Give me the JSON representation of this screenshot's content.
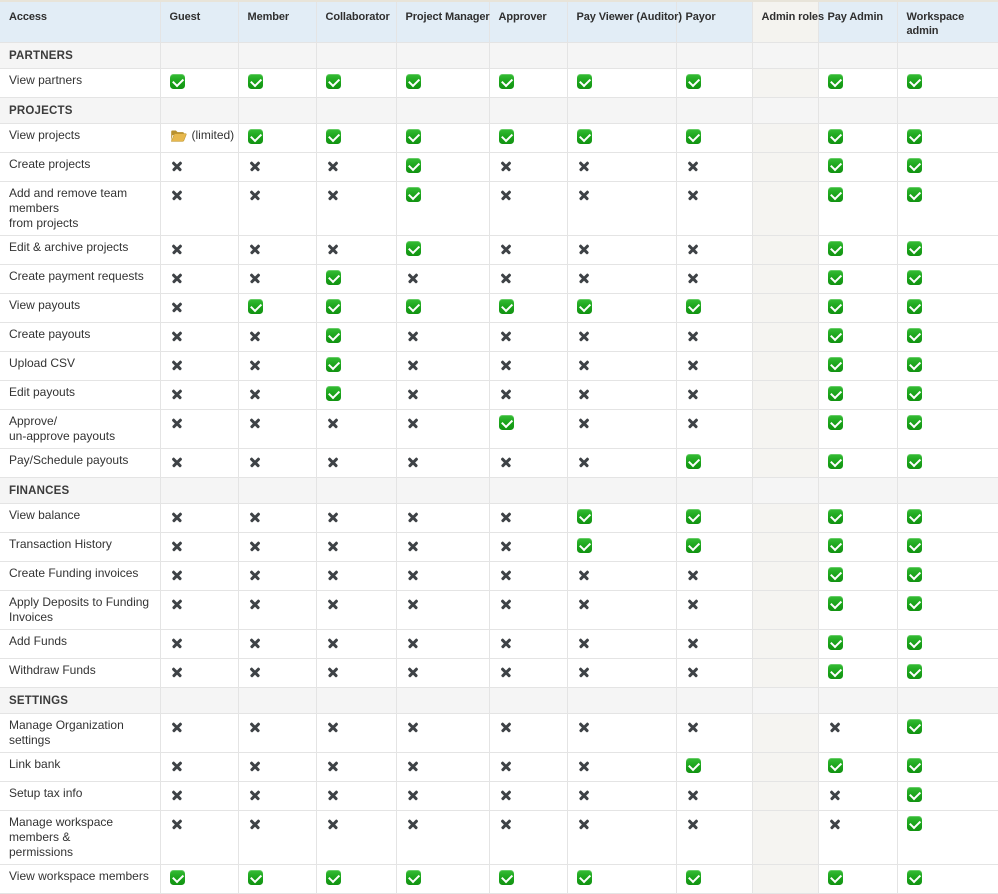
{
  "table": {
    "columns": [
      {
        "label": "Access"
      },
      {
        "label": "Guest"
      },
      {
        "label": "Member"
      },
      {
        "label": "Collaborator"
      },
      {
        "label": "Project Manager"
      },
      {
        "label": "Approver"
      },
      {
        "label": "Pay Viewer (Auditor)"
      },
      {
        "label": "Payor"
      },
      {
        "label": "Admin roles"
      },
      {
        "label": "Pay Admin"
      },
      {
        "label": "Workspace\nadmin"
      }
    ],
    "spacer_column_index": 8,
    "limited_label": "(limited)",
    "colors": {
      "header_bg": "#e2edf6",
      "spacer_header_bg": "#f4f3ef",
      "spacer_column_bg": "#f5f4f1",
      "section_row_bg": "#f5f5f5",
      "border": "#e4e4e4",
      "top_border": "#e8e4d9",
      "check_green": "#1aa21a",
      "cross_gray": "#3e4246",
      "folder_gold": "#e7b84d"
    },
    "rows": [
      {
        "type": "section",
        "label": "PARTNERS"
      },
      {
        "type": "row",
        "label": "View partners",
        "cells": [
          "check",
          "check",
          "check",
          "check",
          "check",
          "check",
          "check",
          "spacer",
          "check",
          "check"
        ]
      },
      {
        "type": "section",
        "label": "PROJECTS"
      },
      {
        "type": "row",
        "label": "View projects",
        "cells": [
          "limited",
          "check",
          "check",
          "check",
          "check",
          "check",
          "check",
          "spacer",
          "check",
          "check"
        ]
      },
      {
        "type": "row",
        "label": "Create projects",
        "cells": [
          "cross",
          "cross",
          "cross",
          "check",
          "cross",
          "cross",
          "cross",
          "spacer",
          "check",
          "check"
        ]
      },
      {
        "type": "row",
        "label": "Add and remove team members\nfrom projects",
        "cells": [
          "cross",
          "cross",
          "cross",
          "check",
          "cross",
          "cross",
          "cross",
          "spacer",
          "check",
          "check"
        ]
      },
      {
        "type": "row",
        "label": "Edit & archive projects",
        "cells": [
          "cross",
          "cross",
          "cross",
          "check",
          "cross",
          "cross",
          "cross",
          "spacer",
          "check",
          "check"
        ]
      },
      {
        "type": "row",
        "label": "Create payment requests",
        "cells": [
          "cross",
          "cross",
          "check",
          "cross",
          "cross",
          "cross",
          "cross",
          "spacer",
          "check",
          "check"
        ]
      },
      {
        "type": "row",
        "label": "View payouts",
        "cells": [
          "cross",
          "check",
          "check",
          "check",
          "check",
          "check",
          "check",
          "spacer",
          "check",
          "check"
        ]
      },
      {
        "type": "row",
        "label": "Create payouts",
        "cells": [
          "cross",
          "cross",
          "check",
          "cross",
          "cross",
          "cross",
          "cross",
          "spacer",
          "check",
          "check"
        ]
      },
      {
        "type": "row",
        "label": "Upload CSV",
        "cells": [
          "cross",
          "cross",
          "check",
          "cross",
          "cross",
          "cross",
          "cross",
          "spacer",
          "check",
          "check"
        ]
      },
      {
        "type": "row",
        "label": "Edit payouts",
        "cells": [
          "cross",
          "cross",
          "check",
          "cross",
          "cross",
          "cross",
          "cross",
          "spacer",
          "check",
          "check"
        ]
      },
      {
        "type": "row",
        "label": "Approve/\nun-approve payouts",
        "cells": [
          "cross",
          "cross",
          "cross",
          "cross",
          "check",
          "cross",
          "cross",
          "spacer",
          "check",
          "check"
        ]
      },
      {
        "type": "row",
        "label": "Pay/Schedule payouts",
        "cells": [
          "cross",
          "cross",
          "cross",
          "cross",
          "cross",
          "cross",
          "check",
          "spacer",
          "check",
          "check"
        ]
      },
      {
        "type": "section",
        "label": "FINANCES"
      },
      {
        "type": "row",
        "label": "View balance",
        "cells": [
          "cross",
          "cross",
          "cross",
          "cross",
          "cross",
          "check",
          "check",
          "spacer",
          "check",
          "check"
        ]
      },
      {
        "type": "row",
        "label": "Transaction History",
        "cells": [
          "cross",
          "cross",
          "cross",
          "cross",
          "cross",
          "check",
          "check",
          "spacer",
          "check",
          "check"
        ]
      },
      {
        "type": "row",
        "label": "Create Funding invoices",
        "cells": [
          "cross",
          "cross",
          "cross",
          "cross",
          "cross",
          "cross",
          "cross",
          "spacer",
          "check",
          "check"
        ]
      },
      {
        "type": "row",
        "label": "Apply Deposits to Funding\nInvoices",
        "cells": [
          "cross",
          "cross",
          "cross",
          "cross",
          "cross",
          "cross",
          "cross",
          "spacer",
          "check",
          "check"
        ]
      },
      {
        "type": "row",
        "label": "Add Funds",
        "cells": [
          "cross",
          "cross",
          "cross",
          "cross",
          "cross",
          "cross",
          "cross",
          "spacer",
          "check",
          "check"
        ]
      },
      {
        "type": "row",
        "label": "Withdraw Funds",
        "cells": [
          "cross",
          "cross",
          "cross",
          "cross",
          "cross",
          "cross",
          "cross",
          "spacer",
          "check",
          "check"
        ]
      },
      {
        "type": "section",
        "label": "SETTINGS"
      },
      {
        "type": "row",
        "label": "Manage Organization settings",
        "cells": [
          "cross",
          "cross",
          "cross",
          "cross",
          "cross",
          "cross",
          "cross",
          "spacer",
          "cross",
          "check"
        ]
      },
      {
        "type": "row",
        "label": "Link bank",
        "cells": [
          "cross",
          "cross",
          "cross",
          "cross",
          "cross",
          "cross",
          "check",
          "spacer",
          "check",
          "check"
        ]
      },
      {
        "type": "row",
        "label": "Setup tax info",
        "cells": [
          "cross",
          "cross",
          "cross",
          "cross",
          "cross",
          "cross",
          "cross",
          "spacer",
          "cross",
          "check"
        ]
      },
      {
        "type": "row",
        "label": "Manage workspace members &\npermissions",
        "cells": [
          "cross",
          "cross",
          "cross",
          "cross",
          "cross",
          "cross",
          "cross",
          "spacer",
          "cross",
          "check"
        ]
      },
      {
        "type": "row",
        "label": "View workspace members",
        "cells": [
          "check",
          "check",
          "check",
          "check",
          "check",
          "check",
          "check",
          "spacer",
          "check",
          "check"
        ]
      }
    ]
  }
}
